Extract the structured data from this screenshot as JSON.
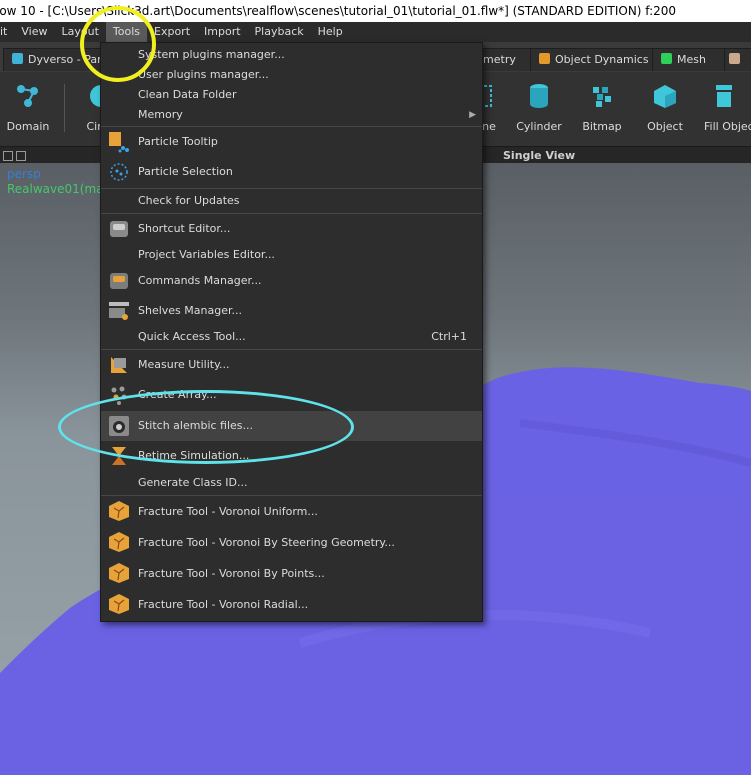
{
  "title_bar": {
    "text": "low 10 - [C:\\Users\\Slick3d.art\\Documents\\realflow\\scenes\\tutorial_01\\tutorial_01.flw*] (STANDARD EDITION) f:200"
  },
  "menubar": {
    "items": [
      "it",
      "View",
      "Layout",
      "Tools",
      "Export",
      "Import",
      "Playback",
      "Help"
    ]
  },
  "tabs": [
    {
      "label": "Dyverso - Parti"
    },
    {
      "label": "Geometry"
    },
    {
      "label": "Object Dynamics"
    },
    {
      "label": "Mesh"
    }
  ],
  "shelf": {
    "tools": [
      "Domain",
      "Circ",
      "ne",
      "Cylinder",
      "Bitmap",
      "Object",
      "Fill Object"
    ]
  },
  "viewport": {
    "title": "Single View",
    "camera_label": "persp",
    "object_label": "Realwave01(ma"
  },
  "tools_menu": {
    "items": [
      {
        "label": "System plugins manager...",
        "shortcut": ""
      },
      {
        "label": "User plugins manager...",
        "shortcut": ""
      },
      {
        "label": "Clean Data Folder",
        "shortcut": ""
      },
      {
        "label": "Memory",
        "shortcut": ""
      },
      {
        "label": "Particle Tooltip",
        "shortcut": ""
      },
      {
        "label": "Particle Selection",
        "shortcut": ""
      },
      {
        "label": "Check for Updates",
        "shortcut": ""
      },
      {
        "label": "Shortcut Editor...",
        "shortcut": ""
      },
      {
        "label": "Project Variables Editor...",
        "shortcut": ""
      },
      {
        "label": "Commands Manager...",
        "shortcut": ""
      },
      {
        "label": "Shelves Manager...",
        "shortcut": ""
      },
      {
        "label": "Quick Access Tool...",
        "shortcut": "Ctrl+1"
      },
      {
        "label": "Measure Utility...",
        "shortcut": ""
      },
      {
        "label": "Create Array...",
        "shortcut": ""
      },
      {
        "label": "Stitch alembic files...",
        "shortcut": ""
      },
      {
        "label": "Retime Simulation...",
        "shortcut": ""
      },
      {
        "label": "Generate Class ID...",
        "shortcut": ""
      },
      {
        "label": "Fracture Tool - Voronoi Uniform...",
        "shortcut": ""
      },
      {
        "label": "Fracture Tool - Voronoi By Steering Geometry...",
        "shortcut": ""
      },
      {
        "label": "Fracture Tool - Voronoi By Points...",
        "shortcut": ""
      },
      {
        "label": "Fracture Tool - Voronoi Radial...",
        "shortcut": ""
      }
    ]
  },
  "colors": {
    "yellow_annotation": "#f2ef1e",
    "cyan_annotation": "#5fe3ea",
    "water_surface": "#6d65e6"
  }
}
